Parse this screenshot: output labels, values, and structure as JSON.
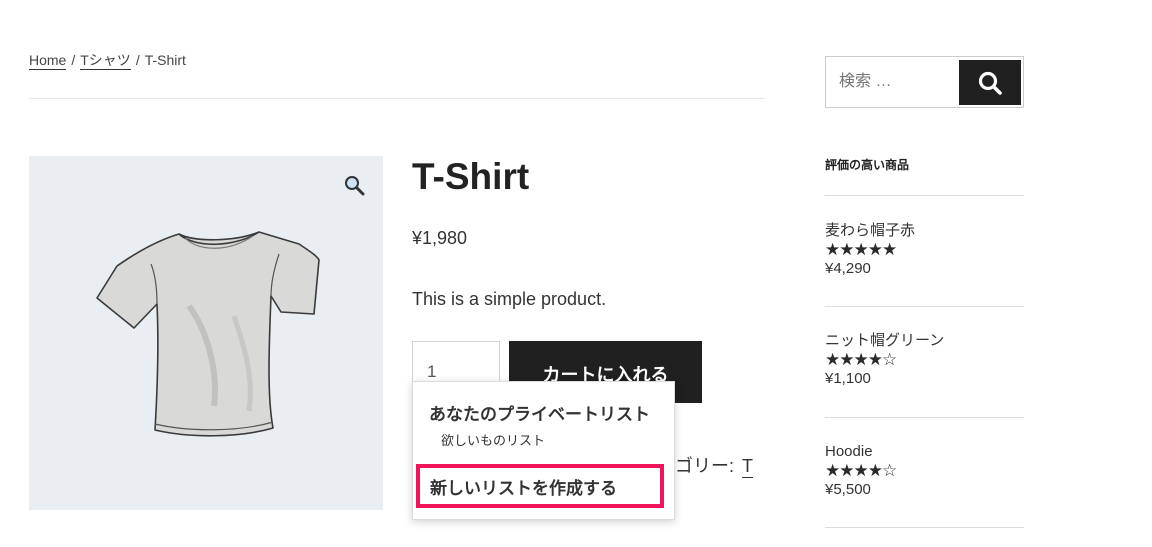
{
  "breadcrumb": {
    "home": "Home",
    "sep1": "/",
    "category": "Tシャツ",
    "sep2": "/",
    "current": "T-Shirt"
  },
  "product": {
    "title": "T-Shirt",
    "price": "¥1,980",
    "description": "This is a simple product.",
    "quantity": "1",
    "add_to_cart": "カートに入れる",
    "category_label": "ゴリー:",
    "category_link": "T"
  },
  "wishlist_popup": {
    "heading": "あなたのプライベートリスト",
    "list_item": "欲しいものリスト",
    "create_new": "新しいリストを作成する",
    "highlight_color": "#f0145a"
  },
  "sidebar": {
    "search_placeholder": "検索 …",
    "widget_title": "評価の高い商品",
    "items": [
      {
        "name": "麦わら帽子赤",
        "stars": "★★★★★",
        "rating": 5,
        "price": "¥4,290"
      },
      {
        "name": "ニット帽グリーン",
        "stars": "★★★★☆",
        "rating": 4,
        "price": "¥1,100"
      },
      {
        "name": "Hoodie",
        "stars": "★★★★☆",
        "rating": 4,
        "price": "¥5,500"
      }
    ]
  }
}
